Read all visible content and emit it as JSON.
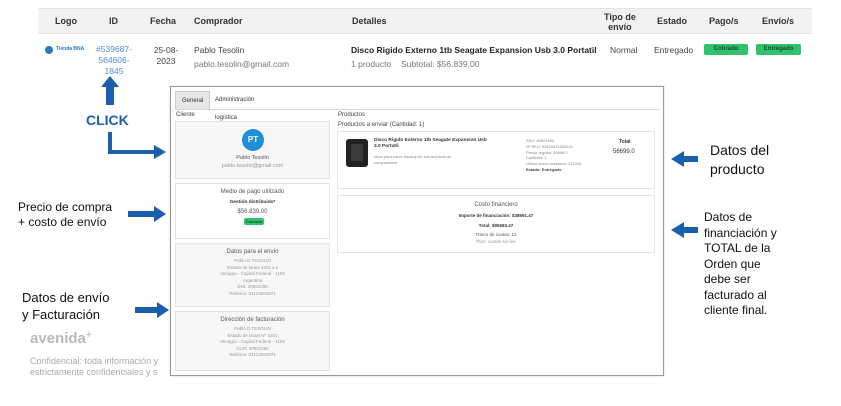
{
  "table": {
    "headers": {
      "logo": "Logo",
      "id": "ID",
      "fecha": "Fecha",
      "comprador": "Comprador",
      "detalles": "Detalles",
      "tipo_envio_1": "Tipo de",
      "tipo_envio_2": "envío",
      "estado": "Estado",
      "pagos": "Pago/s",
      "envios": "Envío/s"
    },
    "row": {
      "logo_label": "Tienda BNA",
      "id_1": "#539687-",
      "id_2": "564606-",
      "id_3": "1845",
      "fecha_1": "25-08-",
      "fecha_2": "2023",
      "comprador_name": "Pablo Tesolin",
      "comprador_email": "pablo.tesolin@gmail.com",
      "detalle_title": "Disco Rigido Externo 1tb Seagate Expansion Usb 3.0 Portatil",
      "detalle_qty": "1 producto",
      "detalle_subtotal": "Subtotal: $56.839,00",
      "tipo_envio": "Normal",
      "estado": "Entregado",
      "pago_badge": "Cobrado",
      "envio_badge": "Entregado"
    }
  },
  "annotations": {
    "click": "CLICK",
    "precio_1": "Precio de compra",
    "precio_2": "+ costo de envío",
    "envio_1": "Datos de envío",
    "envio_2": "y Facturación",
    "producto_1": "Datos del",
    "producto_2": "producto",
    "financ_1": "Datos de",
    "financ_2": "financiación y",
    "financ_3": "TOTAL de la",
    "financ_4": "Orden que",
    "financ_5": "debe ser",
    "financ_6": "facturado al",
    "financ_7": "cliente final."
  },
  "footer": {
    "brand": "avenida",
    "conf_1": "Confidencial: toda información y",
    "conf_2": "estrictamente confidenciales y s"
  },
  "window": {
    "tabs": [
      "General",
      "Administración logística"
    ],
    "cliente_label": "Cliente",
    "productos_label": "Productos",
    "productos_enviar": "Productos a enviar (Cantidad: 1)",
    "avatar_initials": "PT",
    "cliente_name": "Pablo Tesolin",
    "cliente_email": "pablo.tesolin@gmail.com",
    "medio_title": "Medio de pago utilizado",
    "medio_name": "Gestión distribuido*",
    "medio_amount": "$56.839,00",
    "medio_badge": "Cobrado",
    "envio_title": "Datos para el envío",
    "envio_lines": [
      "Pablo.D.TESOLIN",
      "Estado de Israel 4201 s.s",
      "Almagro - Capital Federal - 1185",
      "Argentina",
      "DNI: 30652280",
      "Teléfono: 01123664871"
    ],
    "fact_title": "Dirección de facturación",
    "fact_lines": [
      "Pablo D.TESOLIN",
      "Estado de Israel Nº 4201",
      "Almagro - Capital Federal - 1185",
      "CUIT: 30652280",
      "Teléfono: 01123664871"
    ],
    "prod_title_1": "Disco Rigido Externo 1tb Seagate Expansion Usb",
    "prod_title_2": "3.0 Portatil",
    "prod_desc_1": "Ideal para hacer backup de sus archivos de",
    "prod_desc_2": "computadora",
    "prod_meta": [
      "SKU: 80601650",
      "Nº SKU: 93425321000441",
      "Precio regular: 35698.0",
      "Cantidad: 1",
      "Último envío aceptado: 221045",
      "Estado: Entregado"
    ],
    "total_label": "Total",
    "total_value": "56699.0",
    "costo_title": "Costo financiero",
    "costo_importe": "Importe de financiación: $38691.47",
    "costo_total": "Total: $95583.47",
    "costo_cuotas": "Tramo de cuotas: 12",
    "costo_plan": "Plan: cuotas sin fee"
  }
}
